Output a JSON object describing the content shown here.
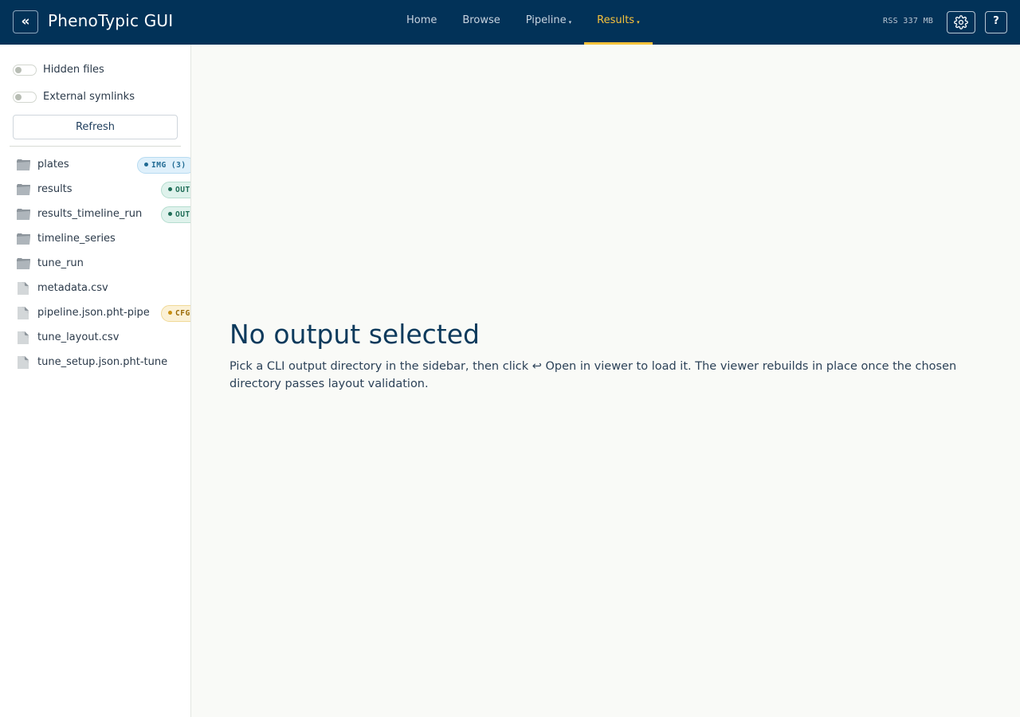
{
  "app": {
    "title": "PhenoTypic GUI",
    "collapse_glyph": "«"
  },
  "nav": {
    "items": [
      {
        "label": "Home",
        "has_caret": false,
        "active": false
      },
      {
        "label": "Browse",
        "has_caret": false,
        "active": false
      },
      {
        "label": "Pipeline",
        "has_caret": true,
        "active": false
      },
      {
        "label": "Results",
        "has_caret": true,
        "active": true
      }
    ],
    "caret_glyph": "▾"
  },
  "status": {
    "rss": "RSS 337 MB"
  },
  "header_buttons": {
    "settings_icon": "gear-icon",
    "help_label": "?"
  },
  "sidebar": {
    "toggles": [
      {
        "label": "Hidden files",
        "on": false
      },
      {
        "label": "External symlinks",
        "on": false
      }
    ],
    "refresh_label": "Refresh",
    "entries": [
      {
        "name": "plates",
        "type": "folder",
        "badge": "IMG (3)",
        "badge_kind": "img"
      },
      {
        "name": "results",
        "type": "folder",
        "badge": "OUT",
        "badge_kind": "out"
      },
      {
        "name": "results_timeline_run",
        "type": "folder",
        "badge": "OUT",
        "badge_kind": "out"
      },
      {
        "name": "timeline_series",
        "type": "folder",
        "badge": "",
        "badge_kind": ""
      },
      {
        "name": "tune_run",
        "type": "folder",
        "badge": "",
        "badge_kind": ""
      },
      {
        "name": "metadata.csv",
        "type": "file",
        "badge": "",
        "badge_kind": ""
      },
      {
        "name": "pipeline.json.pht-pipe",
        "type": "file",
        "badge": "CFG",
        "badge_kind": "cfg"
      },
      {
        "name": "tune_layout.csv",
        "type": "file",
        "badge": "",
        "badge_kind": ""
      },
      {
        "name": "tune_setup.json.pht-tune",
        "type": "file",
        "badge": "",
        "badge_kind": ""
      }
    ]
  },
  "main": {
    "title": "No output selected",
    "description": "Pick a CLI output directory in the sidebar, then click ↩ Open in viewer to load it. The viewer rebuilds in place once the chosen directory passes layout validation."
  },
  "colors": {
    "header_bg": "#023258",
    "accent": "#f6c23b",
    "page_bg": "#f9faf7"
  }
}
